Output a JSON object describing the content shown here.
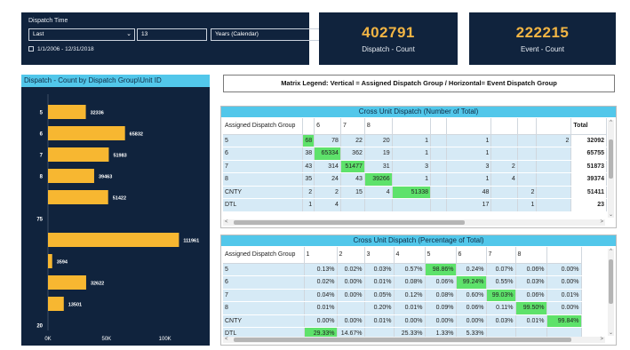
{
  "filter": {
    "title": "Dispatch Time",
    "relative": "Last",
    "count": "13",
    "unit": "Years (Calendar)",
    "date_range": "1/1/2006 - 12/31/2018"
  },
  "kpis": [
    {
      "value": "402791",
      "caption": "Dispatch - Count"
    },
    {
      "value": "222215",
      "caption": "Event - Count"
    }
  ],
  "bar_chart_title": "Dispatch - Count by Dispatch Group\\Unit ID",
  "chart_data": {
    "type": "bar",
    "orientation": "horizontal",
    "title": "Dispatch - Count by Dispatch Group\\Unit ID",
    "categories": [
      "5",
      "6",
      "7",
      "8",
      "",
      "75",
      "",
      "",
      "",
      "",
      "20"
    ],
    "values": [
      32336,
      65832,
      51983,
      39463,
      51422,
      0,
      111961,
      3594,
      32622,
      13501,
      0
    ],
    "data_labels": [
      "32336",
      "65832",
      "51983",
      "39463",
      "51422",
      "",
      "111961",
      "3594",
      "32622",
      "13501",
      ""
    ],
    "xticks": [
      "0K",
      "50K",
      "100K"
    ],
    "xlim": [
      0,
      120000
    ],
    "bar_color": "#f7b731",
    "background": "#10233d"
  },
  "legend_text": "Matrix Legend:    Vertical = Assigned Dispatch Group   /   Horizontal= Event Dispatch Group",
  "matrix_count": {
    "title": "Cross Unit Dispatch (Number of Total)",
    "row_header": "Assigned Dispatch Group",
    "columns": [
      "",
      "6",
      "7",
      "8",
      "",
      "",
      "",
      "",
      "",
      "",
      "Total"
    ],
    "rows": [
      {
        "label": "5",
        "cells": [
          "68",
          "78",
          "22",
          "20",
          "1",
          "",
          "1",
          "",
          "",
          "2",
          "32092"
        ],
        "hi": 0
      },
      {
        "label": "6",
        "cells": [
          "38",
          "65334",
          "362",
          "19",
          "1",
          "",
          "1",
          "",
          "",
          "",
          "65755"
        ],
        "hi": 1
      },
      {
        "label": "7",
        "cells": [
          "43",
          "314",
          "51477",
          "31",
          "3",
          "",
          "3",
          "2",
          "",
          "",
          "51873"
        ],
        "hi": 2
      },
      {
        "label": "8",
        "cells": [
          "35",
          "24",
          "43",
          "39266",
          "1",
          "",
          "1",
          "4",
          "",
          "",
          "39374"
        ],
        "hi": 3
      },
      {
        "label": "CNTY",
        "cells": [
          "2",
          "2",
          "15",
          "4",
          "51338",
          "",
          "48",
          "",
          "2",
          "",
          "51411"
        ],
        "hi": 4
      },
      {
        "label": "DTL",
        "cells": [
          "1",
          "4",
          "",
          "",
          "",
          "",
          "17",
          "",
          "1",
          "",
          "23"
        ],
        "hi": -1
      }
    ]
  },
  "matrix_pct": {
    "title": "Cross Unit Dispatch (Percentage of Total)",
    "row_header": "Assigned Dispatch Group",
    "columns": [
      "1",
      "2",
      "3",
      "4",
      "5",
      "6",
      "7",
      "8",
      ""
    ],
    "rows": [
      {
        "label": "5",
        "cells": [
          "0.13%",
          "0.02%",
          "0.03%",
          "0.57%",
          "98.86%",
          "0.24%",
          "0.07%",
          "0.06%",
          "0.00%"
        ],
        "hi": 4
      },
      {
        "label": "6",
        "cells": [
          "0.02%",
          "0.00%",
          "0.01%",
          "0.08%",
          "0.06%",
          "99.24%",
          "0.55%",
          "0.03%",
          "0.00%"
        ],
        "hi": 5
      },
      {
        "label": "7",
        "cells": [
          "0.04%",
          "0.00%",
          "0.05%",
          "0.12%",
          "0.08%",
          "0.60%",
          "99.03%",
          "0.06%",
          "0.01%"
        ],
        "hi": 6
      },
      {
        "label": "8",
        "cells": [
          "0.01%",
          "",
          "0.20%",
          "0.01%",
          "0.09%",
          "0.06%",
          "0.11%",
          "99.50%",
          "0.00%"
        ],
        "hi": 7
      },
      {
        "label": "CNTY",
        "cells": [
          "0.00%",
          "0.00%",
          "0.01%",
          "0.00%",
          "0.00%",
          "0.00%",
          "0.03%",
          "0.01%",
          "99.84%"
        ],
        "hi": 8
      },
      {
        "label": "DTL",
        "cells": [
          "29.33%",
          "14.67%",
          "",
          "25.33%",
          "1.33%",
          "5.33%",
          "",
          "",
          ""
        ],
        "hi": 0
      }
    ]
  },
  "colors": {
    "navy": "#10233d",
    "accent_cyan": "#52c7ea",
    "kpi_gold": "#f2b544",
    "cell_blue": "#d6eaf6",
    "highlight_green": "#5ee26b"
  }
}
